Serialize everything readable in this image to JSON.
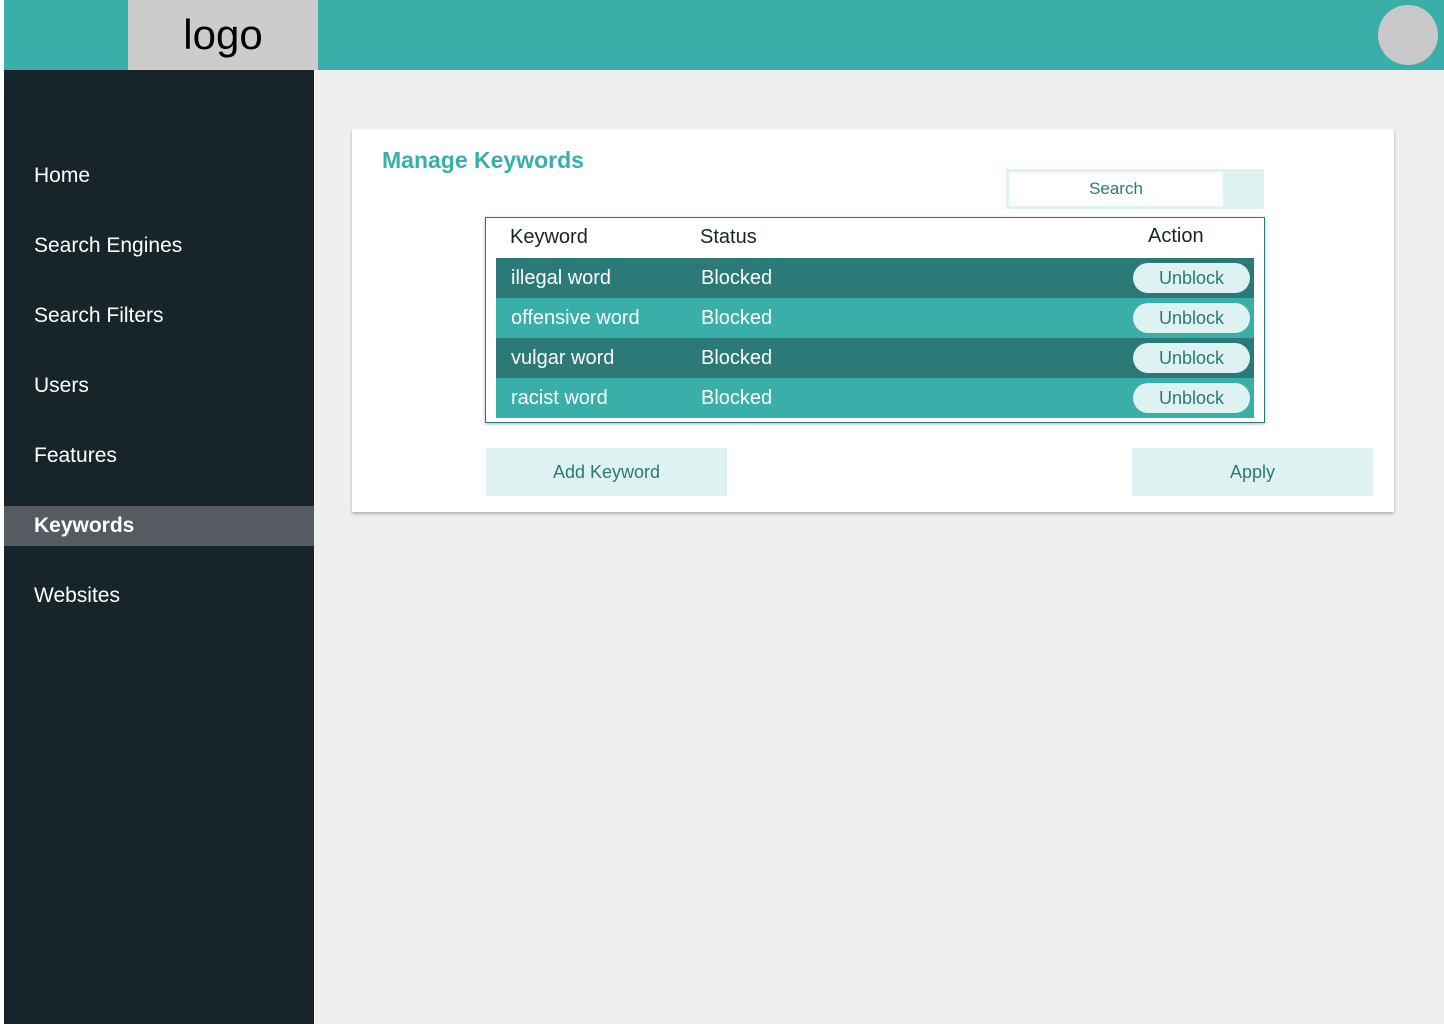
{
  "header": {
    "logo_text": "logo",
    "avatar_icon": "user-avatar-icon"
  },
  "sidebar": {
    "items": [
      {
        "label": "Home",
        "active": false
      },
      {
        "label": "Search Engines",
        "active": false
      },
      {
        "label": "Search Filters",
        "active": false
      },
      {
        "label": "Users",
        "active": false
      },
      {
        "label": "Features",
        "active": false
      },
      {
        "label": "Keywords",
        "active": true
      },
      {
        "label": "Websites",
        "active": false
      }
    ]
  },
  "card": {
    "title": "Manage Keywords",
    "search": {
      "placeholder": "Search",
      "value": ""
    },
    "table": {
      "columns": [
        "Keyword",
        "Status",
        "Action"
      ],
      "rows": [
        {
          "keyword": "illegal word",
          "status": "Blocked",
          "action": "Unblock"
        },
        {
          "keyword": "offensive word",
          "status": "Blocked",
          "action": "Unblock"
        },
        {
          "keyword": "vulgar word",
          "status": "Blocked",
          "action": "Unblock"
        },
        {
          "keyword": "racist word",
          "status": "Blocked",
          "action": "Unblock"
        }
      ]
    },
    "add_keyword_label": "Add Keyword",
    "apply_label": "Apply"
  },
  "colors": {
    "accent": "#3aafa9",
    "accent_dark": "#2b7a78",
    "sidebar_bg": "#17252a",
    "sidebar_active": "#555b60",
    "button_bg": "#def2f1",
    "content_bg": "#efefef"
  }
}
